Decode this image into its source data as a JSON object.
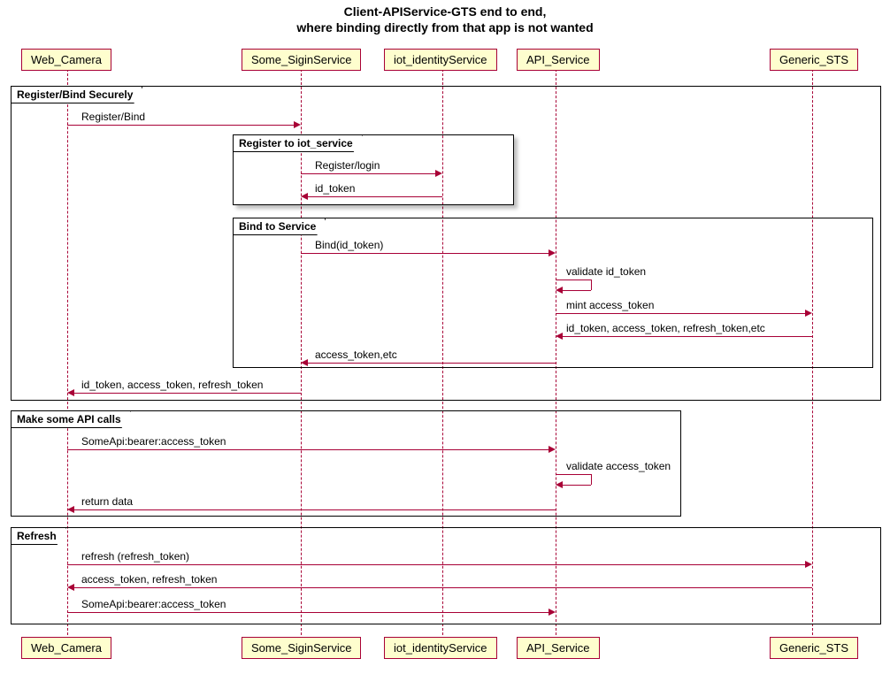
{
  "title_line1": "Client-APIService-GTS end to end,",
  "title_line2": "where binding directly from that app is not wanted",
  "participants": {
    "p1": "Web_Camera",
    "p2": "Some_SiginService",
    "p3": "iot_identityService",
    "p4": "API_Service",
    "p5": "Generic_STS"
  },
  "groups": {
    "g1": "Register/Bind Securely",
    "g2": "Register to iot_service",
    "g3": "Bind to Service",
    "g4": "Make some API calls",
    "g5": "Refresh"
  },
  "messages": {
    "m1": "Register/Bind",
    "m2": "Register/login",
    "m3": "id_token",
    "m4": "Bind(id_token)",
    "m5": "validate id_token",
    "m6": "mint access_token",
    "m7": "id_token, access_token, refresh_token,etc",
    "m8": "access_token,etc",
    "m9": "id_token, access_token, refresh_token",
    "m10": "SomeApi:bearer:access_token",
    "m11": "validate access_token",
    "m12": "return data",
    "m13": "refresh (refresh_token)",
    "m14": "access_token, refresh_token",
    "m15": "SomeApi:bearer:access_token"
  },
  "chart_data": {
    "type": "sequence-diagram",
    "participants": [
      "Web_Camera",
      "Some_SiginService",
      "iot_identityService",
      "API_Service",
      "Generic_STS"
    ],
    "groups": [
      {
        "label": "Register/Bind Securely",
        "contains": [
          "m1",
          "g2",
          "g3",
          "m9"
        ],
        "nested": [
          {
            "label": "Register to iot_service",
            "messages": [
              "m2",
              "m3"
            ]
          },
          {
            "label": "Bind to Service",
            "messages": [
              "m4",
              "m5",
              "m6",
              "m7",
              "m8"
            ]
          }
        ]
      },
      {
        "label": "Make some API calls",
        "messages": [
          "m10",
          "m11",
          "m12"
        ]
      },
      {
        "label": "Refresh",
        "messages": [
          "m13",
          "m14",
          "m15"
        ]
      }
    ],
    "messages": [
      {
        "id": "m1",
        "from": "Web_Camera",
        "to": "Some_SiginService",
        "label": "Register/Bind"
      },
      {
        "id": "m2",
        "from": "Some_SiginService",
        "to": "iot_identityService",
        "label": "Register/login"
      },
      {
        "id": "m3",
        "from": "iot_identityService",
        "to": "Some_SiginService",
        "label": "id_token"
      },
      {
        "id": "m4",
        "from": "Some_SiginService",
        "to": "API_Service",
        "label": "Bind(id_token)"
      },
      {
        "id": "m5",
        "from": "API_Service",
        "to": "API_Service",
        "label": "validate id_token"
      },
      {
        "id": "m6",
        "from": "API_Service",
        "to": "Generic_STS",
        "label": "mint access_token"
      },
      {
        "id": "m7",
        "from": "Generic_STS",
        "to": "API_Service",
        "label": "id_token, access_token, refresh_token,etc"
      },
      {
        "id": "m8",
        "from": "API_Service",
        "to": "Some_SiginService",
        "label": "access_token,etc"
      },
      {
        "id": "m9",
        "from": "Some_SiginService",
        "to": "Web_Camera",
        "label": "id_token, access_token, refresh_token"
      },
      {
        "id": "m10",
        "from": "Web_Camera",
        "to": "API_Service",
        "label": "SomeApi:bearer:access_token"
      },
      {
        "id": "m11",
        "from": "API_Service",
        "to": "API_Service",
        "label": "validate access_token"
      },
      {
        "id": "m12",
        "from": "API_Service",
        "to": "Web_Camera",
        "label": "return data"
      },
      {
        "id": "m13",
        "from": "Web_Camera",
        "to": "Generic_STS",
        "label": "refresh (refresh_token)"
      },
      {
        "id": "m14",
        "from": "Generic_STS",
        "to": "Web_Camera",
        "label": "access_token, refresh_token"
      },
      {
        "id": "m15",
        "from": "Web_Camera",
        "to": "API_Service",
        "label": "SomeApi:bearer:access_token"
      }
    ]
  }
}
